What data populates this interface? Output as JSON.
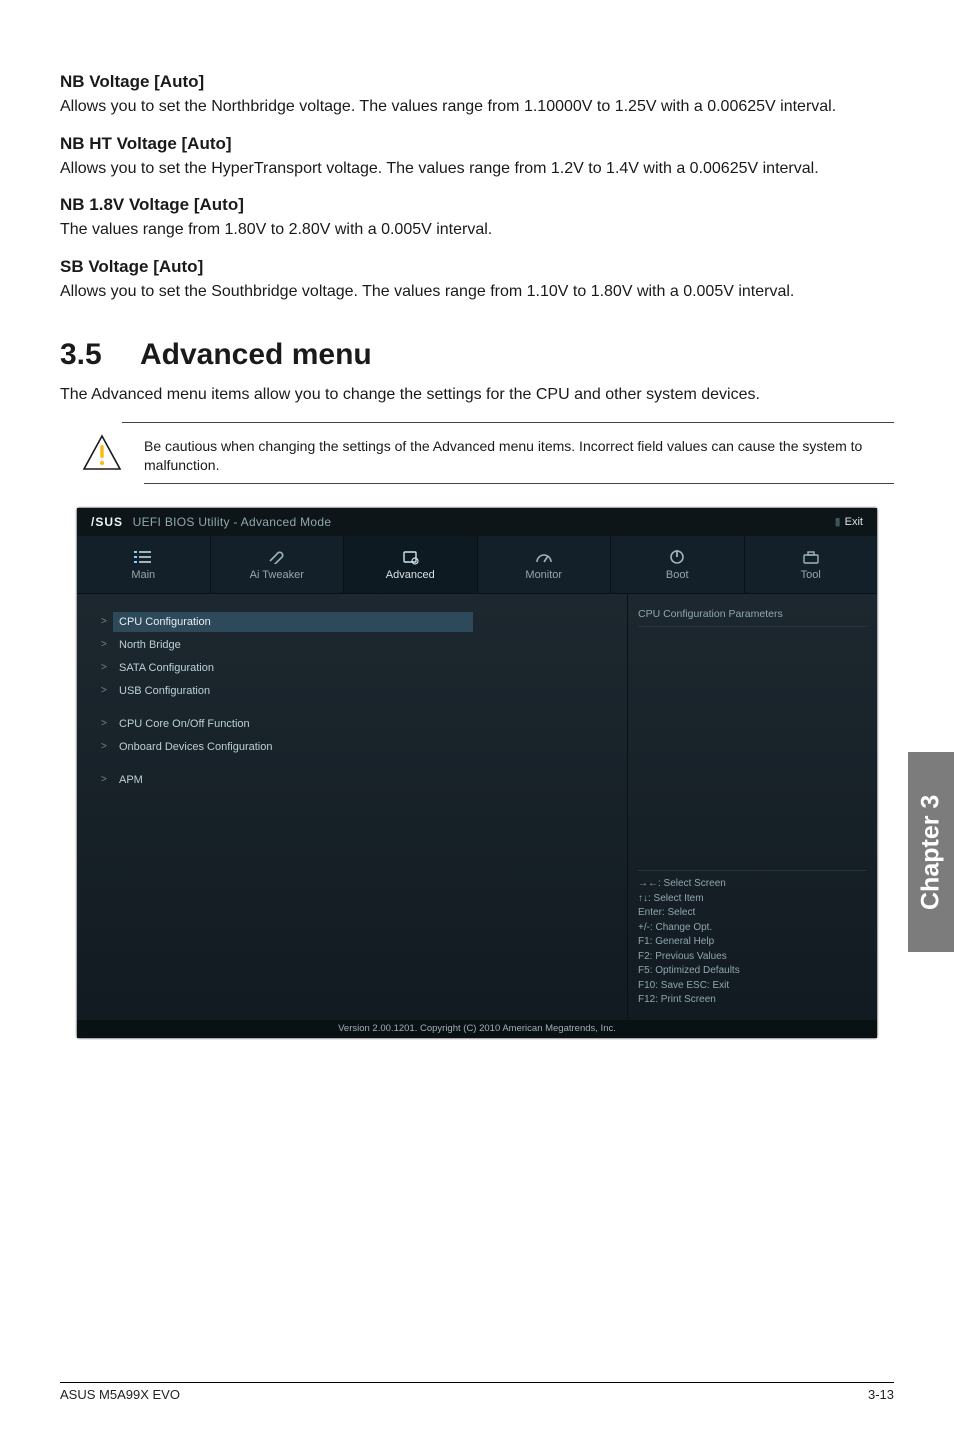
{
  "sections": {
    "nb_voltage": {
      "heading": "NB Voltage [Auto]",
      "body": "Allows you to set the Northbridge voltage. The values range from 1.10000V to 1.25V with a 0.00625V interval."
    },
    "nb_ht_voltage": {
      "heading": "NB HT Voltage [Auto]",
      "body": "Allows you to set the HyperTransport voltage. The values range from 1.2V to 1.4V with a 0.00625V interval."
    },
    "nb_18v_voltage": {
      "heading": "NB 1.8V Voltage [Auto]",
      "body": "The values range from 1.80V to 2.80V with a 0.005V interval."
    },
    "sb_voltage": {
      "heading": "SB Voltage [Auto]",
      "body": "Allows you to set the Southbridge voltage. The values range from 1.10V to 1.80V with a 0.005V interval."
    }
  },
  "advanced_menu": {
    "number": "3.5",
    "title": "Advanced menu",
    "intro": "The Advanced menu items allow you to change the settings for the CPU and other system devices.",
    "caution": "Be cautious when changing the settings of the Advanced menu items. Incorrect field values can cause the system to malfunction."
  },
  "bios": {
    "brand_logo": "/SUS",
    "brand_tag": "UEFI BIOS Utility - Advanced Mode",
    "exit_label": "Exit",
    "tabs": {
      "main": "Main",
      "ai_tweaker": "Ai  Tweaker",
      "advanced": "Advanced",
      "monitor": "Monitor",
      "boot": "Boot",
      "tool": "Tool"
    },
    "items": {
      "cpu_config": "CPU Configuration",
      "north_bridge": "North Bridge",
      "sata_config": "SATA Configuration",
      "usb_config": "USB Configuration",
      "cpu_core_onoff": "CPU Core On/Off Function",
      "onboard_devices": "Onboard Devices Configuration",
      "apm": "APM"
    },
    "right_panel_title": "CPU Configuration Parameters",
    "help": {
      "l1": "→←:  Select Screen",
      "l2": "↑↓:  Select Item",
      "l3": "Enter:  Select",
      "l4": "+/-:  Change Opt.",
      "l5": "F1:  General Help",
      "l6": "F2:  Previous Values",
      "l7": "F5:  Optimized Defaults",
      "l8": "F10:  Save   ESC:  Exit",
      "l9": "F12: Print Screen"
    },
    "footer": "Version  2.00.1201.   Copyright  (C)  2010  American  Megatrends,  Inc."
  },
  "side_tab": "Chapter 3",
  "footer": {
    "left": "ASUS M5A99X EVO",
    "right": "3-13"
  }
}
